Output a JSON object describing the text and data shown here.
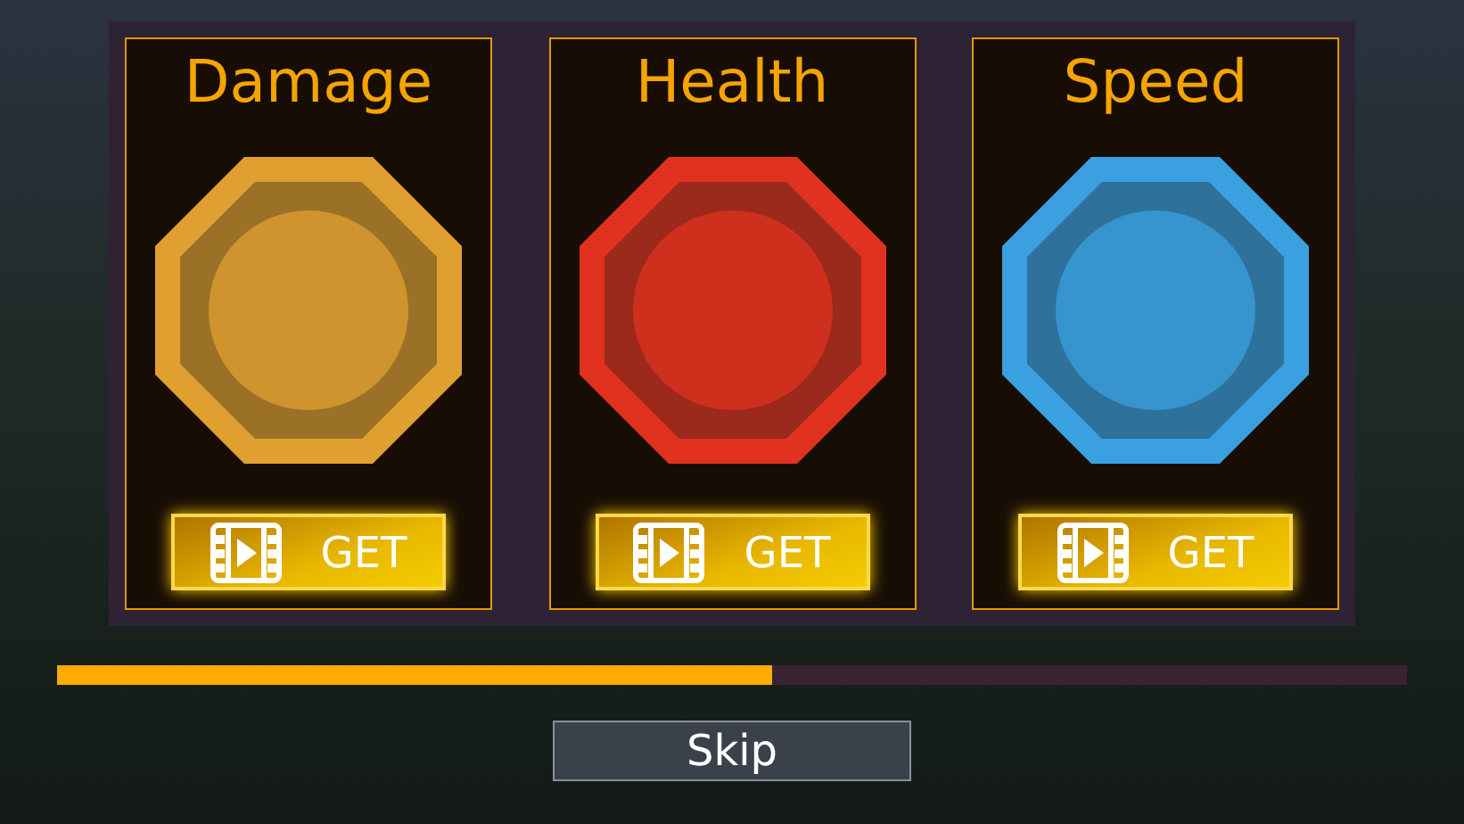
{
  "cards": [
    {
      "title": "Damage",
      "color": "#e0a030",
      "button": "GET"
    },
    {
      "title": "Health",
      "color": "#e0321e",
      "button": "GET"
    },
    {
      "title": "Speed",
      "color": "#3aa0e0",
      "button": "GET"
    }
  ],
  "progress": {
    "level": 0.53
  },
  "skip_button": "Skip"
}
